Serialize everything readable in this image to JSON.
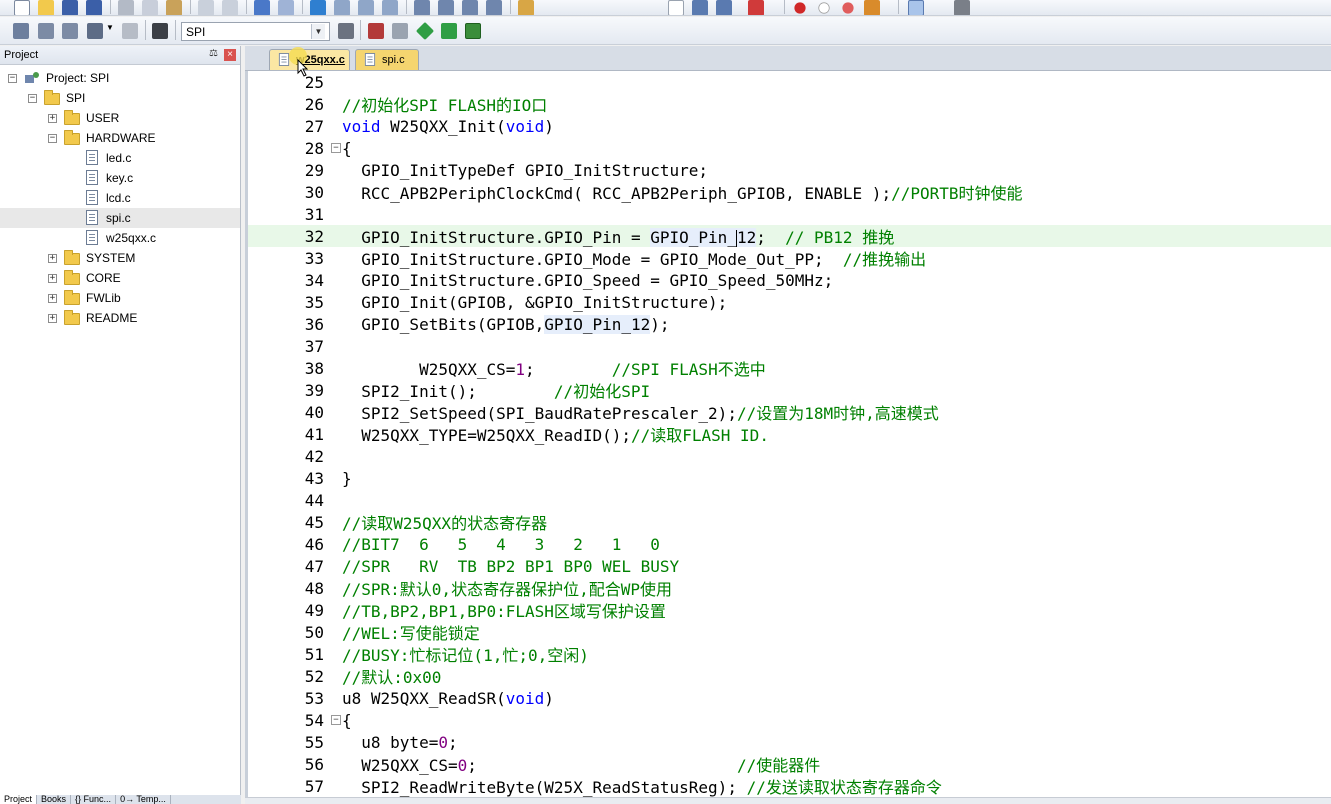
{
  "toolbar": {
    "target_name": "SPI"
  },
  "project_panel": {
    "title": "Project",
    "pin_label": "⚖",
    "close_label": "×",
    "tree": [
      {
        "label": "Project: SPI",
        "level": 0,
        "kind": "project",
        "expanded": true
      },
      {
        "label": "SPI",
        "level": 1,
        "kind": "target",
        "expanded": true
      },
      {
        "label": "USER",
        "level": 2,
        "kind": "folder",
        "expanded": false
      },
      {
        "label": "HARDWARE",
        "level": 2,
        "kind": "folder",
        "expanded": true
      },
      {
        "label": "led.c",
        "level": 3,
        "kind": "file"
      },
      {
        "label": "key.c",
        "level": 3,
        "kind": "file"
      },
      {
        "label": "lcd.c",
        "level": 3,
        "kind": "file"
      },
      {
        "label": "spi.c",
        "level": 3,
        "kind": "file",
        "selected": true
      },
      {
        "label": "w25qxx.c",
        "level": 3,
        "kind": "file"
      },
      {
        "label": "SYSTEM",
        "level": 2,
        "kind": "folder",
        "expanded": false
      },
      {
        "label": "CORE",
        "level": 2,
        "kind": "folder",
        "expanded": false
      },
      {
        "label": "FWLib",
        "level": 2,
        "kind": "folder",
        "expanded": false
      },
      {
        "label": "README",
        "level": 2,
        "kind": "folder",
        "expanded": false
      }
    ],
    "bottom_tabs": [
      "Project",
      "Books",
      "{} Func...",
      "0→ Temp..."
    ]
  },
  "editor": {
    "tabs": [
      {
        "label": "w25qxx.c",
        "active": true
      },
      {
        "label": "spi.c",
        "active": false
      }
    ],
    "lines": [
      {
        "n": "25",
        "parts": []
      },
      {
        "n": "26",
        "parts": [
          {
            "t": "//初始化SPI FLASH的IO口",
            "c": "cmt"
          }
        ]
      },
      {
        "n": "27",
        "parts": [
          {
            "t": "void",
            "c": "kw"
          },
          {
            "t": " W25QXX_Init(",
            "c": ""
          },
          {
            "t": "void",
            "c": "kw"
          },
          {
            "t": ")",
            "c": ""
          }
        ]
      },
      {
        "n": "28",
        "fold": "−",
        "parts": [
          {
            "t": "{",
            "c": ""
          }
        ]
      },
      {
        "n": "29",
        "parts": [
          {
            "t": "  GPIO_InitTypeDef GPIO_InitStructure;",
            "c": ""
          }
        ]
      },
      {
        "n": "30",
        "parts": [
          {
            "t": "  RCC_APB2PeriphClockCmd( RCC_APB2Periph_GPIOB, ENABLE );",
            "c": ""
          },
          {
            "t": "//PORTB时钟使能",
            "c": "cmt"
          }
        ]
      },
      {
        "n": "31",
        "parts": []
      },
      {
        "n": "32",
        "current": true,
        "parts": [
          {
            "t": "  GPIO_InitStructure.GPIO_Pin = ",
            "c": ""
          },
          {
            "t": "GPIO_Pin_",
            "c": "hl"
          },
          {
            "t": "|",
            "c": "caret"
          },
          {
            "t": "12",
            "c": "hl"
          },
          {
            "t": ";  ",
            "c": ""
          },
          {
            "t": "// PB12 推挽",
            "c": "cmt"
          }
        ]
      },
      {
        "n": "33",
        "parts": [
          {
            "t": "  GPIO_InitStructure.GPIO_Mode = GPIO_Mode_Out_PP;  ",
            "c": ""
          },
          {
            "t": "//推挽输出",
            "c": "cmt"
          }
        ]
      },
      {
        "n": "34",
        "parts": [
          {
            "t": "  GPIO_InitStructure.GPIO_Speed = GPIO_Speed_50MHz;",
            "c": ""
          }
        ]
      },
      {
        "n": "35",
        "parts": [
          {
            "t": "  GPIO_Init(GPIOB, &GPIO_InitStructure);",
            "c": ""
          }
        ]
      },
      {
        "n": "36",
        "parts": [
          {
            "t": "  GPIO_SetBits(GPIOB,",
            "c": ""
          },
          {
            "t": "GPIO_Pin_12",
            "c": "hl"
          },
          {
            "t": ");",
            "c": ""
          }
        ]
      },
      {
        "n": "37",
        "parts": []
      },
      {
        "n": "38",
        "parts": [
          {
            "t": "        W25QXX_CS=",
            "c": ""
          },
          {
            "t": "1",
            "c": "num"
          },
          {
            "t": ";        ",
            "c": ""
          },
          {
            "t": "//SPI FLASH不选中",
            "c": "cmt"
          }
        ]
      },
      {
        "n": "39",
        "parts": [
          {
            "t": "  SPI2_Init();        ",
            "c": ""
          },
          {
            "t": "//初始化SPI",
            "c": "cmt"
          }
        ]
      },
      {
        "n": "40",
        "parts": [
          {
            "t": "  SPI2_SetSpeed(SPI_BaudRatePrescaler_2);",
            "c": ""
          },
          {
            "t": "//设置为18M时钟,高速模式",
            "c": "cmt"
          }
        ]
      },
      {
        "n": "41",
        "parts": [
          {
            "t": "  W25QXX_TYPE=W25QXX_ReadID();",
            "c": ""
          },
          {
            "t": "//读取FLASH ID.",
            "c": "cmt"
          }
        ]
      },
      {
        "n": "42",
        "parts": []
      },
      {
        "n": "43",
        "parts": [
          {
            "t": "}",
            "c": ""
          }
        ]
      },
      {
        "n": "44",
        "parts": []
      },
      {
        "n": "45",
        "parts": [
          {
            "t": "//读取W25QXX的状态寄存器",
            "c": "cmt"
          }
        ]
      },
      {
        "n": "46",
        "parts": [
          {
            "t": "//BIT7  6   5   4   3   2   1   0",
            "c": "cmt"
          }
        ]
      },
      {
        "n": "47",
        "parts": [
          {
            "t": "//SPR   RV  TB BP2 BP1 BP0 WEL BUSY",
            "c": "cmt"
          }
        ]
      },
      {
        "n": "48",
        "parts": [
          {
            "t": "//SPR:默认0,状态寄存器保护位,配合WP使用",
            "c": "cmt"
          }
        ]
      },
      {
        "n": "49",
        "parts": [
          {
            "t": "//TB,BP2,BP1,BP0:FLASH区域写保护设置",
            "c": "cmt"
          }
        ]
      },
      {
        "n": "50",
        "parts": [
          {
            "t": "//WEL:写使能锁定",
            "c": "cmt"
          }
        ]
      },
      {
        "n": "51",
        "parts": [
          {
            "t": "//BUSY:忙标记位(1,忙;0,空闲)",
            "c": "cmt"
          }
        ]
      },
      {
        "n": "52",
        "parts": [
          {
            "t": "//默认:0x00",
            "c": "cmt"
          }
        ]
      },
      {
        "n": "53",
        "parts": [
          {
            "t": "u8 W25QXX_ReadSR(",
            "c": ""
          },
          {
            "t": "void",
            "c": "kw"
          },
          {
            "t": ")",
            "c": ""
          }
        ]
      },
      {
        "n": "54",
        "fold": "−",
        "parts": [
          {
            "t": "{",
            "c": ""
          }
        ]
      },
      {
        "n": "55",
        "parts": [
          {
            "t": "  u8 byte=",
            "c": ""
          },
          {
            "t": "0",
            "c": "num"
          },
          {
            "t": ";",
            "c": ""
          }
        ]
      },
      {
        "n": "56",
        "parts": [
          {
            "t": "  W25QXX_CS=",
            "c": ""
          },
          {
            "t": "0",
            "c": "num"
          },
          {
            "t": ";                           ",
            "c": ""
          },
          {
            "t": "//使能器件",
            "c": "cmt"
          }
        ]
      },
      {
        "n": "57",
        "parts": [
          {
            "t": "  SPI2_ReadWriteByte(W25X_ReadStatusReg); ",
            "c": ""
          },
          {
            "t": "//发送读取状态寄存器命令",
            "c": "cmt"
          }
        ]
      }
    ]
  }
}
